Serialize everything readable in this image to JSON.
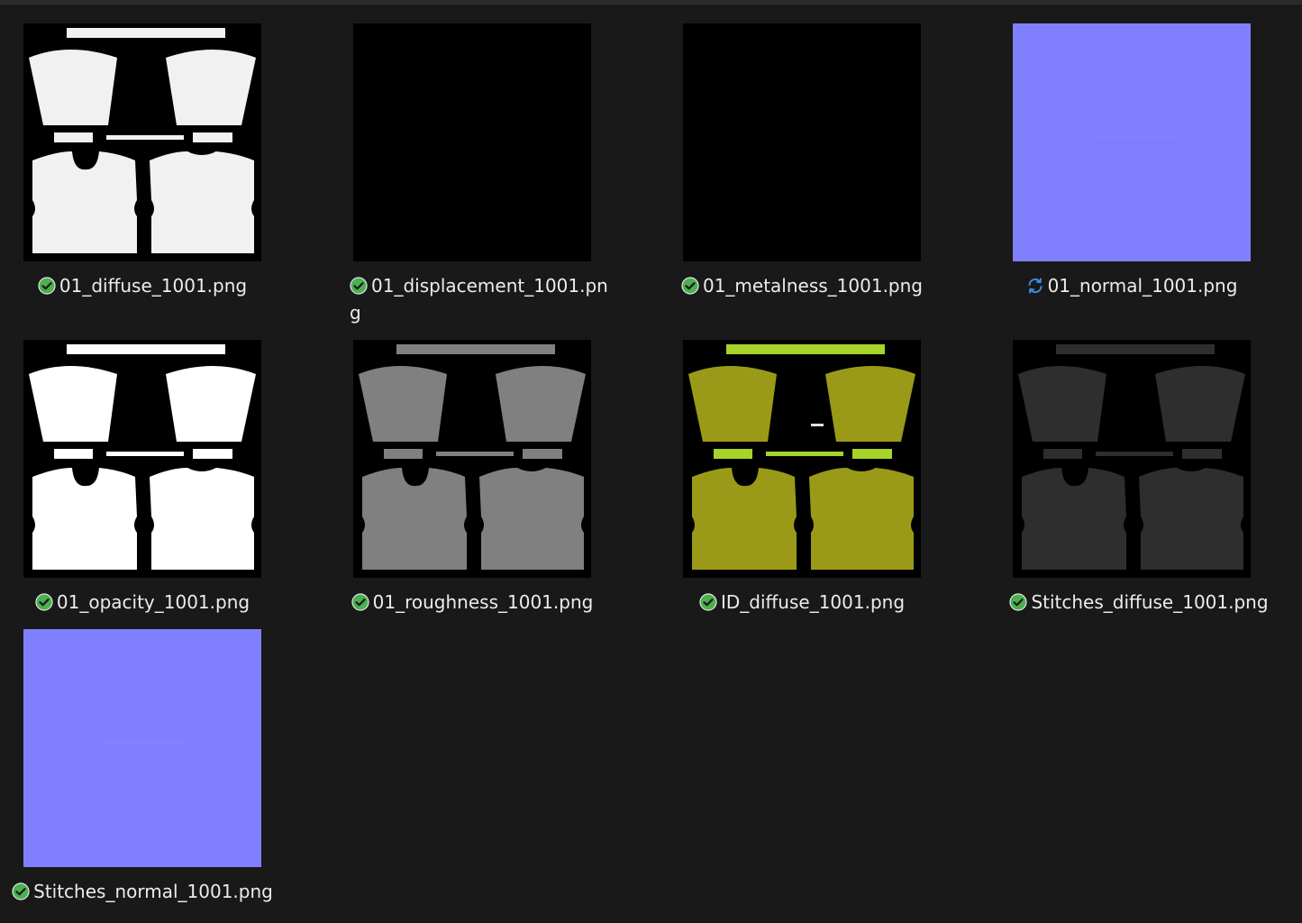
{
  "files": [
    {
      "name": "01_diffuse_1001.png",
      "status": "synced",
      "status_icon": "check-circle-icon",
      "thumb": "uv-white"
    },
    {
      "name": "01_displacement_1001.pn\ng",
      "status": "synced",
      "status_icon": "check-circle-icon",
      "thumb": "black"
    },
    {
      "name": "01_metalness_1001.png",
      "status": "synced",
      "status_icon": "check-circle-icon",
      "thumb": "black"
    },
    {
      "name": "01_normal_1001.png",
      "status": "syncing",
      "status_icon": "sync-arrows-icon",
      "thumb": "normal"
    },
    {
      "name": "01_opacity_1001.png",
      "status": "synced",
      "status_icon": "check-circle-icon",
      "thumb": "uv-white-bright"
    },
    {
      "name": "01_roughness_1001.png",
      "status": "synced",
      "status_icon": "check-circle-icon",
      "thumb": "uv-gray"
    },
    {
      "name": "ID_diffuse_1001.png",
      "status": "synced",
      "status_icon": "check-circle-icon",
      "thumb": "uv-olive"
    },
    {
      "name": "Stitches_diffuse_1001.png",
      "status": "synced",
      "status_icon": "check-circle-icon",
      "thumb": "uv-dark"
    },
    {
      "name": "Stitches_normal_1001.png",
      "status": "synced",
      "status_icon": "check-circle-icon",
      "thumb": "normal"
    }
  ],
  "colors": {
    "background": "#191919",
    "text": "#ececec",
    "synced_green": "#4caf50",
    "sync_blue": "#3a8ee6",
    "normal_map": "#8080ff",
    "uv_white": "#f1f1f1",
    "uv_gray": "#808080",
    "uv_olive": "#9a9a18",
    "uv_lime": "#a6d42a",
    "uv_dark": "#2e2e2e"
  }
}
